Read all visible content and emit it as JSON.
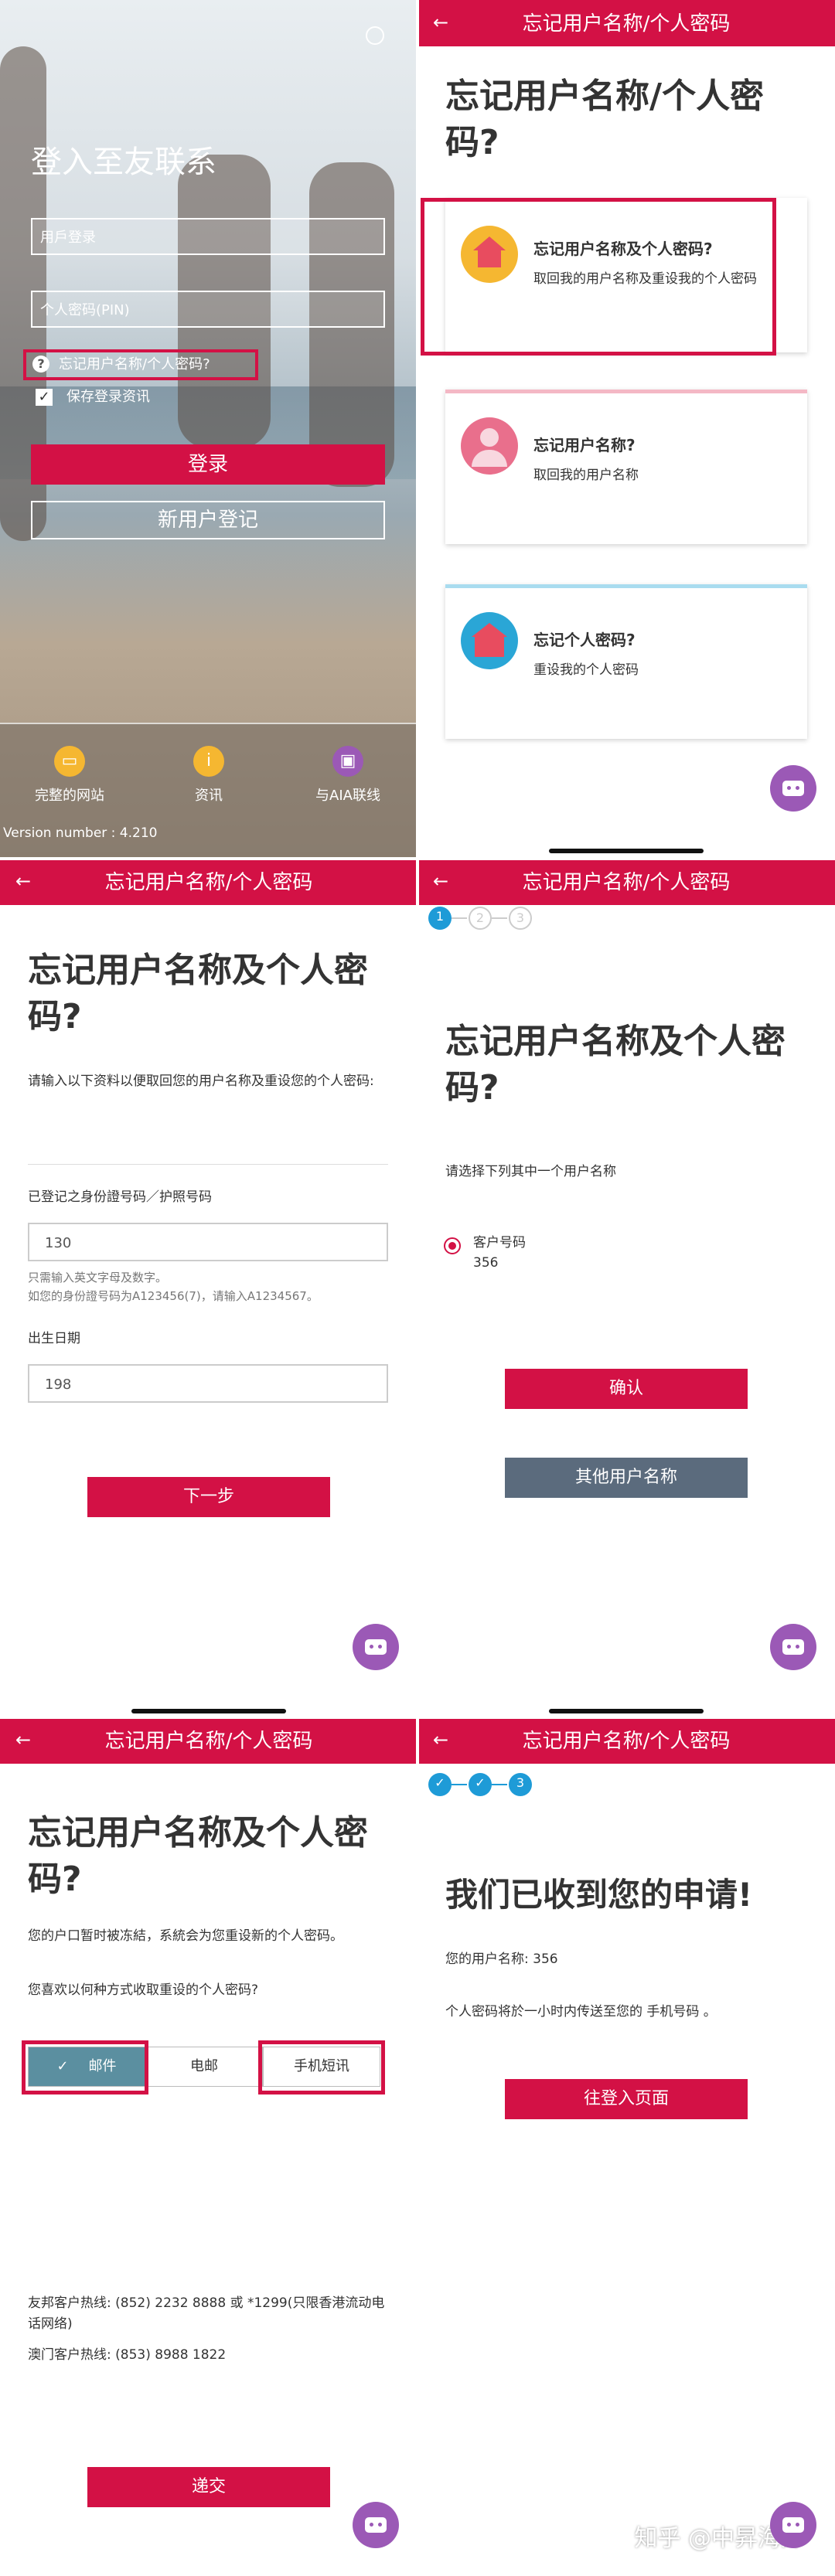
{
  "common": {
    "header_title": "忘记用户名称/个人密码",
    "back_icon": "←",
    "chatbot_icon": "robot-icon",
    "accent_color": "#d31145"
  },
  "panel1": {
    "title": "登入至友联系",
    "username_placeholder": "用戶登录",
    "password_placeholder": "个人密码(PIN)",
    "forgot_link": "忘记用户名称/个人密码?",
    "save_login": "保存登录资讯",
    "login_button": "登录",
    "register_button": "新用户登记",
    "bottom_items": [
      {
        "label": "完整的网站",
        "icon": "website-icon"
      },
      {
        "label": "资讯",
        "icon": "info-icon"
      },
      {
        "label": "与AIA联线",
        "icon": "chat-icon"
      }
    ],
    "version": "Version number : 4.210"
  },
  "panel2": {
    "heading": "忘记用户名称/个人密码?",
    "cards": [
      {
        "title": "忘记用户名称及个人密码?",
        "subtitle": "取回我的用户名称及重设我的个人密码",
        "icon": "home-icon",
        "color": "#f5b731"
      },
      {
        "title": "忘记用户名称?",
        "subtitle": "取回我的用户名称",
        "icon": "person-icon",
        "color": "#e96f8c"
      },
      {
        "title": "忘记个人密码?",
        "subtitle": "重设我的个人密码",
        "icon": "lock-icon",
        "color": "#2aa6d6"
      }
    ]
  },
  "panel3": {
    "heading": "忘记用户名称及个人密码?",
    "intro": "请输入以下资料以便取回您的用户名称及重设您的个人密码:",
    "id_label": "已登记之身份證号码／护照号码",
    "id_value": "130",
    "id_hint1": "只需输入英文字母及数字。",
    "id_hint2": "如您的身份證号码为A123456(7)，请输入A1234567。",
    "dob_label": "出生日期",
    "dob_value": "198",
    "next_button": "下一步"
  },
  "panel4": {
    "steps": [
      "1",
      "2",
      "3"
    ],
    "heading": "忘记用户名称及个人密码?",
    "prompt": "请选择下列其中一个用户名称",
    "option_label": "客户号码",
    "option_value": "356",
    "confirm_button": "确认",
    "other_button": "其他用户名称"
  },
  "panel5": {
    "heading": "忘记用户名称及个人密码?",
    "para1": "您的户口暂时被冻結，系統会为您重设新的个人密码。",
    "para2": "您喜欢以何种方式收取重设的个人密码?",
    "options": [
      "邮件",
      "电邮",
      "手机短讯"
    ],
    "check_icon": "✓",
    "hotline_hk": "友邦客户热线: (852) 2232 8888 或 *1299(只限香港流动电话网络)",
    "hotline_mo": "澳门客户热线: (853) 8988 1822",
    "submit_button": "递交"
  },
  "panel6": {
    "steps": [
      "✓",
      "✓",
      "3"
    ],
    "heading": "我们已收到您的申请!",
    "username_line": "您的用户名称: 356",
    "sent_line": "个人密码将於一小时内传送至您的 手机号码 。",
    "login_page_button": "往登入页面",
    "watermark": "知乎 @中昇海外"
  }
}
